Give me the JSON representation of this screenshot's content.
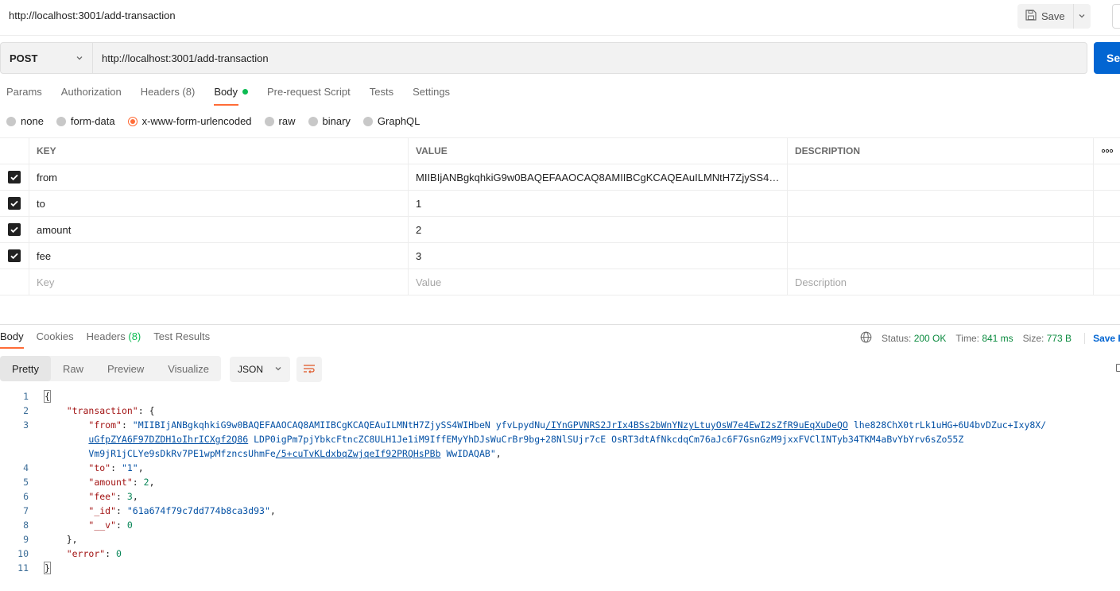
{
  "request": {
    "title": "http://localhost:3001/add-transaction",
    "method": "POST",
    "url": "http://localhost:3001/add-transaction",
    "save_label": "Save",
    "send_label": "Se"
  },
  "req_tabs": [
    "Params",
    "Authorization",
    "Headers (8)",
    "Body",
    "Pre-request Script",
    "Tests",
    "Settings"
  ],
  "body_types": [
    "none",
    "form-data",
    "x-www-form-urlencoded",
    "raw",
    "binary",
    "GraphQL"
  ],
  "table": {
    "headers": {
      "key": "KEY",
      "value": "VALUE",
      "description": "DESCRIPTION"
    },
    "rows": [
      {
        "key": "from",
        "value": "MIIBIjANBgkqhkiG9w0BAQEFAAOCAQ8AMIIBCgKCAQEAuILMNtH7ZjySS4WIHb...",
        "checked": true
      },
      {
        "key": "to",
        "value": "1",
        "checked": true
      },
      {
        "key": "amount",
        "value": "2",
        "checked": true
      },
      {
        "key": "fee",
        "value": "3",
        "checked": true
      }
    ],
    "placeholders": {
      "key": "Key",
      "value": "Value",
      "description": "Description"
    }
  },
  "res_tabs": {
    "body": "Body",
    "cookies": "Cookies",
    "headers": "Headers",
    "headers_count": "(8)",
    "test_results": "Test Results"
  },
  "status": {
    "status_label": "Status:",
    "status_value": "200 OK",
    "time_label": "Time:",
    "time_value": "841 ms",
    "size_label": "Size:",
    "size_value": "773 B",
    "save_response": "Save Re"
  },
  "view_modes": [
    "Pretty",
    "Raw",
    "Preview",
    "Visualize"
  ],
  "format": "JSON",
  "code": {
    "line_numbers": [
      "1",
      "2",
      "3",
      "4",
      "5",
      "6",
      "7",
      "8",
      "9",
      "10",
      "11"
    ],
    "from_key": "\"from\"",
    "from_l1a": "\"MIIBIjANBgkqhkiG9w0BAQEFAAOCAQ8AMIIBCgKCAQEAuILMNtH7ZjySS4WIHbeN yfvLpydNu",
    "from_l1b": "/IYnGPVNRS2JrIx4BSs2bWnYNzyLtuyOsW7e4EwI2sZfR9uEqXuDeQO",
    "from_l1c": " lhe828ChX0trLk1uHG+6U4bvDZuc+Ixy8X/",
    "from_l2a": "uGfpZYA6F97DZDH1oIhrICXgf2Q86",
    "from_l2b": " LDP0igPm7pjYbkcFtncZC8ULH1Je1iM9IffEMyYhDJsWuCrBr9bg+28NlSUjr7cE OsRT3dtAfNkcdqCm76aJc6F7GsnGzM9jxxFVClINTyb34TKM4aBvYbYrv6sZo55Z",
    "from_l3a": "Vm9jR1jCLYe9sDkRv7PE1wpMfzncsUhmFe",
    "from_l3b": "/5+cuTvKLdxbqZwjqeIf92PRQHsPBb",
    "from_l3c": " WwIDAQAB\"",
    "key_transaction": "\"transaction\"",
    "key_to": "\"to\"",
    "val_to": "\"1\"",
    "key_amount": "\"amount\"",
    "val_amount": "2",
    "key_fee": "\"fee\"",
    "val_fee": "3",
    "key_id": "\"_id\"",
    "val_id": "\"61a674f79c7dd774b8ca3d93\"",
    "key_v": "\"__v\"",
    "val_v": "0",
    "key_error": "\"error\"",
    "val_error": "0"
  },
  "colors": {
    "accent": "#ff6c37",
    "send": "#0265d2",
    "status_ok": "#0cbb52"
  }
}
